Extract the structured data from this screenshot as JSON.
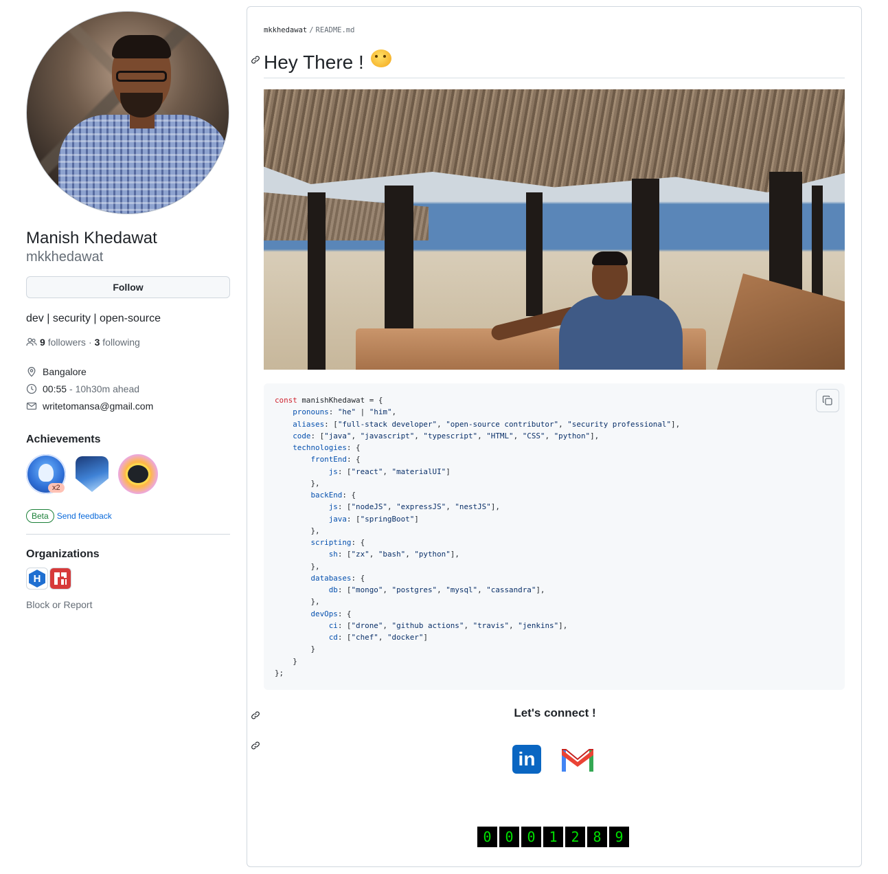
{
  "profile": {
    "name": "Manish Khedawat",
    "login": "mkkhedawat",
    "follow_label": "Follow",
    "bio": "dev | security | open-source",
    "followers_count": "9",
    "followers_label": "followers",
    "separator": "·",
    "following_count": "3",
    "following_label": "following",
    "location": "Bangalore",
    "local_time": "00:55",
    "time_offset": "- 10h30m ahead",
    "email": "writetomansa@gmail.com"
  },
  "achievements": {
    "title": "Achievements",
    "badges": [
      {
        "icon": "shark-badge-icon",
        "multiplier": "x2"
      },
      {
        "icon": "pull-shark-badge-icon"
      },
      {
        "icon": "starstruck-badge-icon"
      }
    ],
    "beta_label": "Beta",
    "feedback_label": "Send feedback"
  },
  "organizations": {
    "title": "Organizations",
    "items": [
      {
        "icon": "hexagon-h-org-icon",
        "letter": "H"
      },
      {
        "icon": "red-puzzle-org-icon"
      }
    ],
    "block_label": "Block or Report"
  },
  "readme": {
    "breadcrumb_user": "mkkhedawat",
    "breadcrumb_sep": "/",
    "breadcrumb_file": "README.md",
    "heading": "Hey There !",
    "connect_heading": "Let's connect !",
    "social": [
      {
        "icon": "linkedin-icon",
        "label": "in"
      },
      {
        "icon": "gmail-icon"
      }
    ],
    "visitor_counter": [
      "0",
      "0",
      "0",
      "1",
      "2",
      "8",
      "9"
    ]
  },
  "colors": {
    "link": "#0969da",
    "beta_green": "#1a7f37",
    "border": "#d0d7de",
    "muted": "#656d76",
    "counter_green": "#00e000",
    "linkedin_blue": "#0a66c2"
  }
}
